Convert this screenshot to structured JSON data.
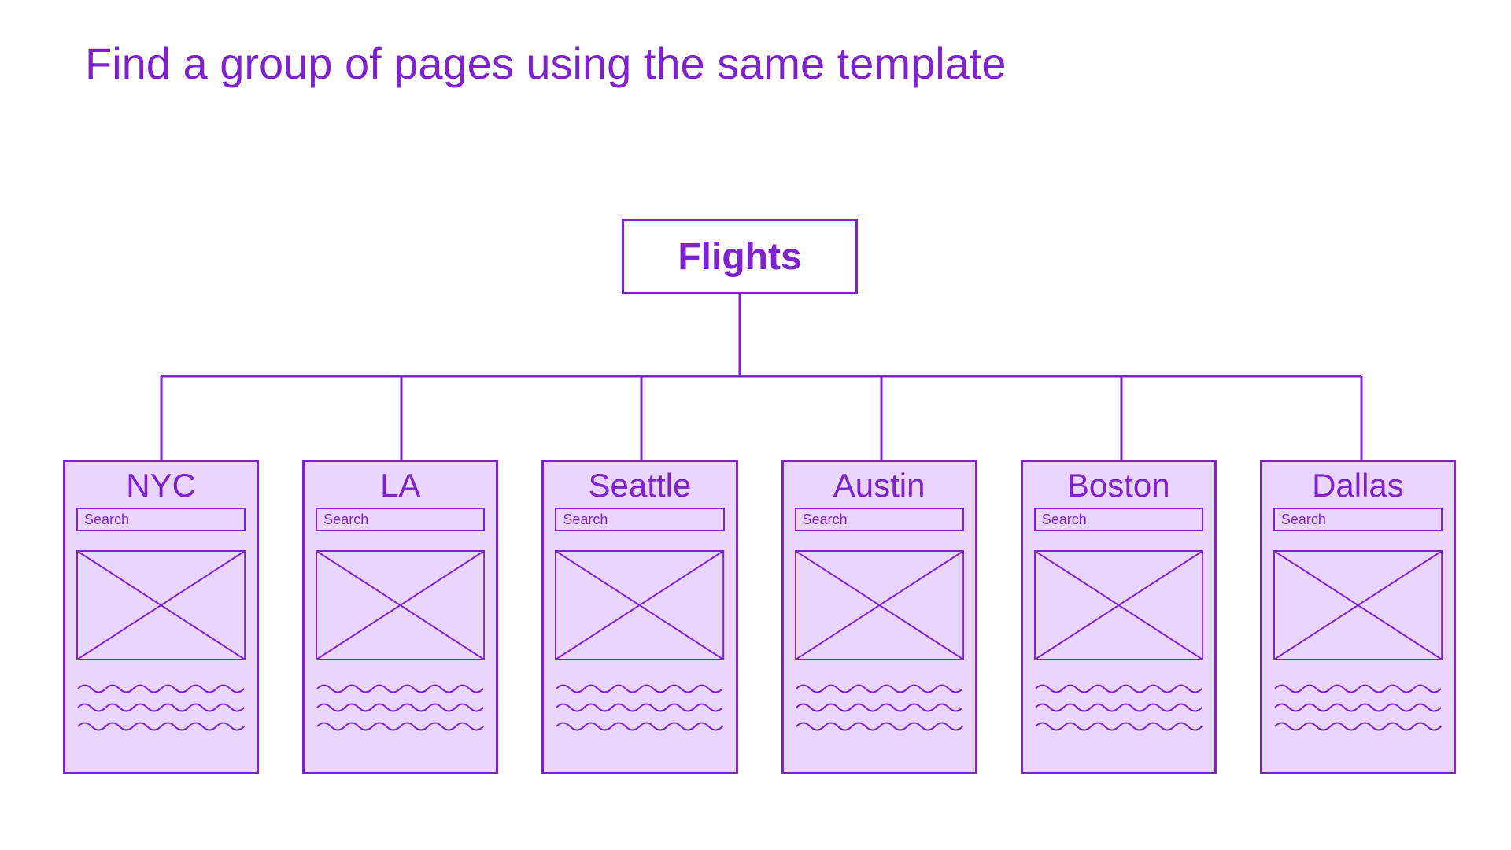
{
  "title": "Find a group of pages using the same template",
  "root": {
    "label": "Flights"
  },
  "search_label": "Search",
  "cards": [
    {
      "title": "NYC"
    },
    {
      "title": "LA"
    },
    {
      "title": "Seattle"
    },
    {
      "title": "Austin"
    },
    {
      "title": "Boston"
    },
    {
      "title": "Dallas"
    }
  ],
  "colors": {
    "purple": "#7e22ce",
    "lilac": "#e9d5ff"
  }
}
